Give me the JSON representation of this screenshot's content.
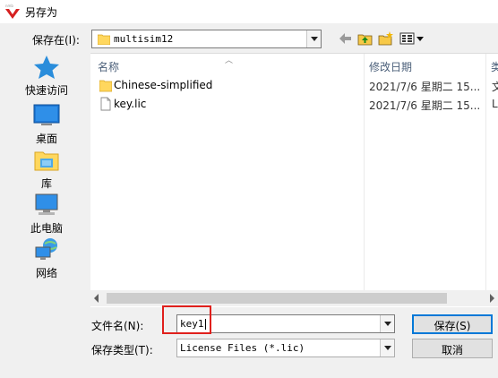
{
  "window": {
    "title": "另存为",
    "app_icon": "multisim-logo-icon"
  },
  "save_in": {
    "label": "保存在(I):",
    "value": "multisim12"
  },
  "places": [
    {
      "label": "快速访问",
      "icon": "star-icon"
    },
    {
      "label": "桌面",
      "icon": "desktop-icon"
    },
    {
      "label": "库",
      "icon": "library-icon"
    },
    {
      "label": "此电脑",
      "icon": "computer-icon"
    },
    {
      "label": "网络",
      "icon": "network-icon"
    }
  ],
  "list": {
    "columns": {
      "name": "名称",
      "date": "修改日期",
      "extra": "类"
    },
    "rows": [
      {
        "name": "Chinese-simplified",
        "date": "2021/7/6 星期二 15...",
        "extra": "文",
        "type": "folder"
      },
      {
        "name": "key.lic",
        "date": "2021/7/6 星期二 15...",
        "extra": "L",
        "type": "file"
      }
    ]
  },
  "form": {
    "filename_label": "文件名(N):",
    "filename_value": "key1",
    "filetype_label": "保存类型(T):",
    "filetype_value": "License Files (*.lic)"
  },
  "buttons": {
    "save": "保存(S)",
    "cancel": "取消"
  },
  "colors": {
    "highlight": "#e0201c",
    "folder": "#ffd75e",
    "accent": "#0078d7"
  }
}
